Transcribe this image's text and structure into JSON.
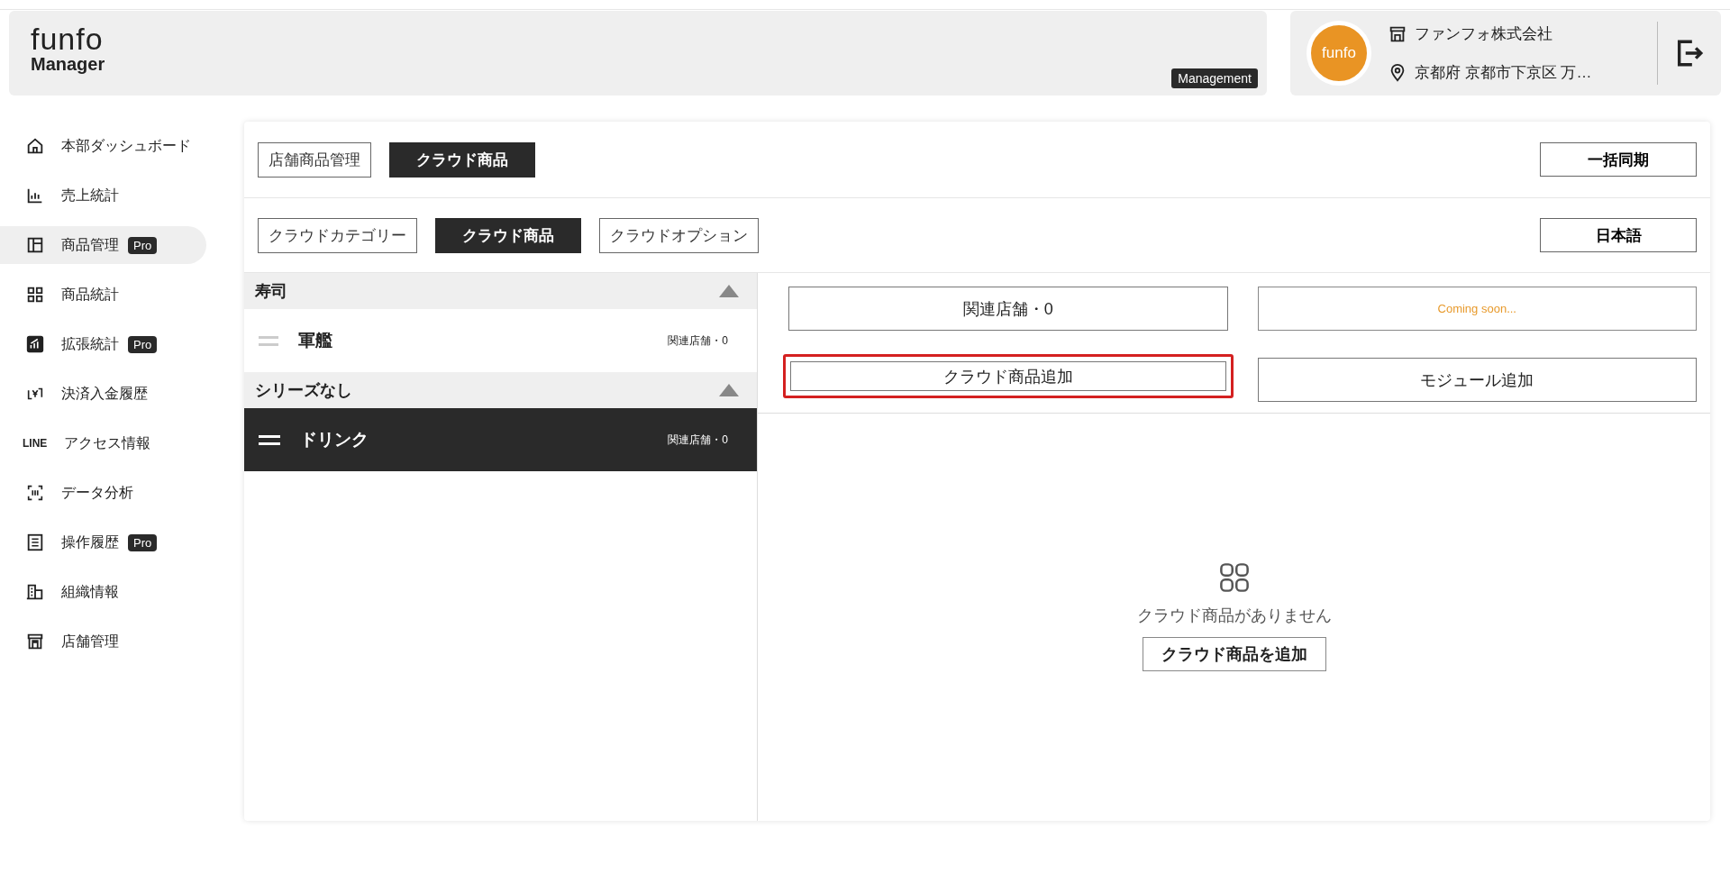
{
  "header": {
    "logo": "funfo",
    "app_name": "Manager",
    "badge": "Management",
    "avatar_text": "funfo",
    "company": "ファンフォ株式会社",
    "address": "京都府 京都市下京区 万…"
  },
  "sidebar": {
    "items": [
      {
        "label": "本部ダッシュボード",
        "selected": false
      },
      {
        "label": "売上統計",
        "selected": false
      },
      {
        "label": "商品管理",
        "badge": "Pro",
        "selected": true
      },
      {
        "label": "商品統計",
        "selected": false
      },
      {
        "label": "拡張統計",
        "badge": "Pro",
        "selected": false
      },
      {
        "label": "決済入金履歴",
        "selected": false
      },
      {
        "label": "アクセス情報",
        "icon_text": "LINE",
        "selected": false
      },
      {
        "label": "データ分析",
        "selected": false
      },
      {
        "label": "操作履歴",
        "badge": "Pro",
        "selected": false
      },
      {
        "label": "組織情報",
        "selected": false
      },
      {
        "label": "店舗管理",
        "selected": false
      }
    ]
  },
  "top_tabs": [
    {
      "label": "店舗商品管理",
      "selected": false
    },
    {
      "label": "クラウド商品",
      "selected": true
    }
  ],
  "sync_button": "一括同期",
  "sub_tabs": [
    {
      "label": "クラウドカテゴリー",
      "selected": false
    },
    {
      "label": "クラウド商品",
      "selected": true
    },
    {
      "label": "クラウドオプション",
      "selected": false
    }
  ],
  "language_button": "日本語",
  "groups": [
    {
      "name": "寿司",
      "expanded": true,
      "items": [
        {
          "name": "軍艦",
          "meta": "関連店舗・0",
          "selected": false
        }
      ]
    },
    {
      "name": "シリーズなし",
      "expanded": true,
      "items": [
        {
          "name": "ドリンク",
          "meta": "関連店舗・0",
          "selected": true
        }
      ]
    }
  ],
  "actions": [
    {
      "label": "関連店舗・0",
      "kind": "button",
      "focused": false
    },
    {
      "label": "Coming soon...",
      "kind": "notice",
      "focused": false
    },
    {
      "label": "クラウド商品追加",
      "kind": "button",
      "focused": true
    },
    {
      "label": "モジュール追加",
      "kind": "button",
      "focused": false
    }
  ],
  "empty_state": {
    "message": "クラウド商品がありません",
    "button": "クラウド商品を追加"
  }
}
